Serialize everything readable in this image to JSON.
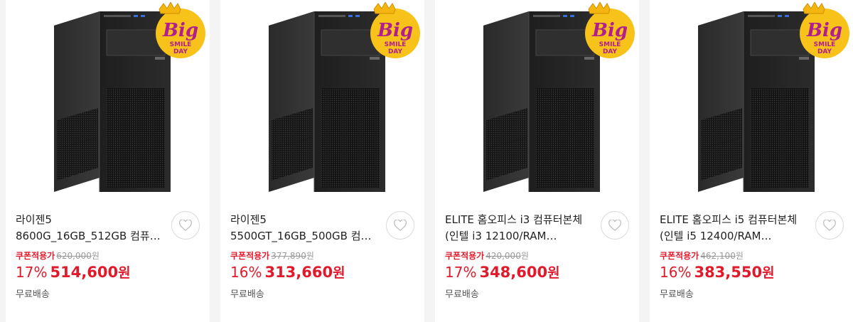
{
  "products": [
    {
      "title_line1": "라이젠5",
      "title_line2": "8600G_16GB_512GB 컴퓨…",
      "badge": {
        "top": "Big",
        "bottom1": "SMILE",
        "bottom2": "DAY"
      },
      "coupon_label": "쿠폰적용가",
      "original_price": "620,000",
      "original_unit": "원",
      "discount_rate": "17%",
      "price": "514,600",
      "price_unit": "원",
      "shipping": "무료배송"
    },
    {
      "title_line1": "라이젠5",
      "title_line2": "5500GT_16GB_500GB 컴…",
      "badge": {
        "top": "Big",
        "bottom1": "SMILE",
        "bottom2": "DAY"
      },
      "coupon_label": "쿠폰적용가",
      "original_price": "377,890",
      "original_unit": "원",
      "discount_rate": "16%",
      "price": "313,660",
      "price_unit": "원",
      "shipping": "무료배송"
    },
    {
      "title_line1": "ELITE 홈오피스 i3 컴퓨터본체",
      "title_line2": "(인텔 i3 12100/RAM…",
      "badge": {
        "top": "Big",
        "bottom1": "SMILE",
        "bottom2": "DAY"
      },
      "coupon_label": "쿠폰적용가",
      "original_price": "420,000",
      "original_unit": "원",
      "discount_rate": "17%",
      "price": "348,600",
      "price_unit": "원",
      "shipping": "무료배송"
    },
    {
      "title_line1": "ELITE 홈오피스 i5 컴퓨터본체",
      "title_line2": "(인텔 i5 12400/RAM…",
      "badge": {
        "top": "Big",
        "bottom1": "SMILE",
        "bottom2": "DAY"
      },
      "coupon_label": "쿠폰적용가",
      "original_price": "462,100",
      "original_unit": "원",
      "discount_rate": "16%",
      "price": "383,550",
      "price_unit": "원",
      "shipping": "무료배송"
    }
  ],
  "colors": {
    "accent_red": "#e11a2b",
    "badge_yellow": "#f7c21a",
    "badge_purple": "#b01e8f",
    "page_bg": "#f4f4f4"
  },
  "icons": {
    "wishlist": "heart-outline-icon",
    "product_image": "pc-tower-case",
    "badge": "big-smile-day-badge"
  }
}
